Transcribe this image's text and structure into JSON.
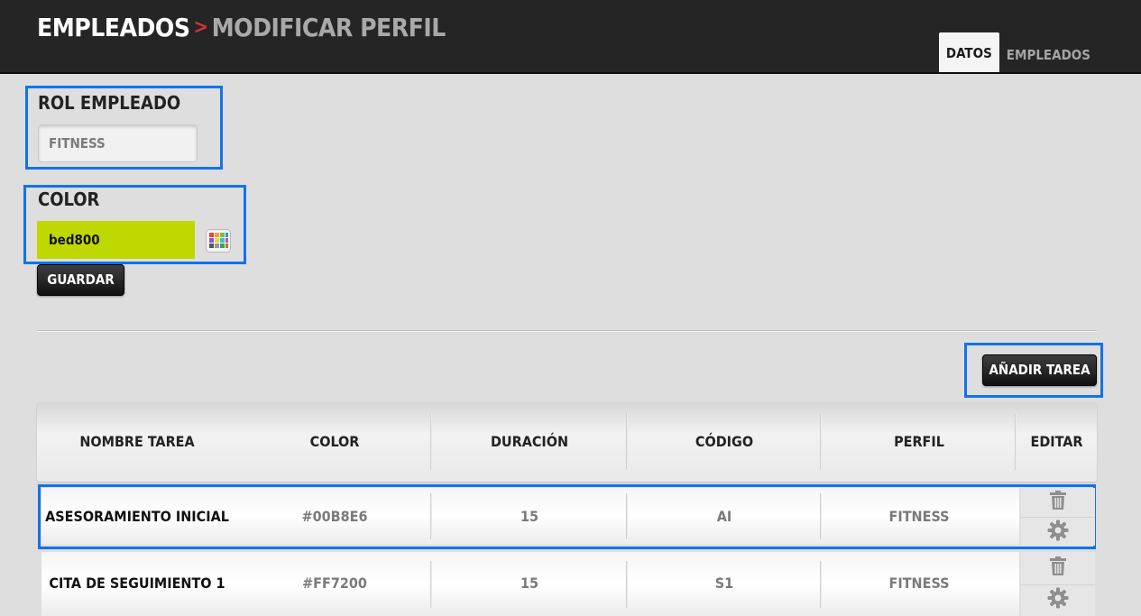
{
  "header": {
    "breadcrumb_section": "EMPLEADOS",
    "breadcrumb_separator": ">",
    "breadcrumb_page": "MODIFICAR PERFIL",
    "tabs": [
      {
        "label": "DATOS"
      },
      {
        "label": "EMPLEADOS"
      }
    ]
  },
  "form": {
    "rol_label": "ROL EMPLEADO",
    "rol_value": "FITNESS",
    "color_label": "COLOR",
    "color_value": "bed800",
    "save_label": "GUARDAR"
  },
  "tasks": {
    "add_label": "AÑADIR TAREA",
    "columns": [
      "NOMBRE TAREA",
      "COLOR",
      "DURACIÓN",
      "CÓDIGO",
      "PERFIL",
      "EDITAR"
    ],
    "rows": [
      {
        "name": "ASESORAMIENTO INICIAL",
        "color": "#00B8E6",
        "duration": "15",
        "code": "AI",
        "profile": "FITNESS"
      },
      {
        "name": "CITA DE SEGUIMIENTO 1",
        "color": "#FF7200",
        "duration": "15",
        "code": "S1",
        "profile": "FITNESS"
      }
    ]
  },
  "icons": {
    "palette": "palette-icon",
    "delete": "trash-icon",
    "edit": "gear-icon"
  },
  "colors": {
    "role_color": "#bed800",
    "highlight": "#1273ea",
    "accent": "#d0343a"
  }
}
